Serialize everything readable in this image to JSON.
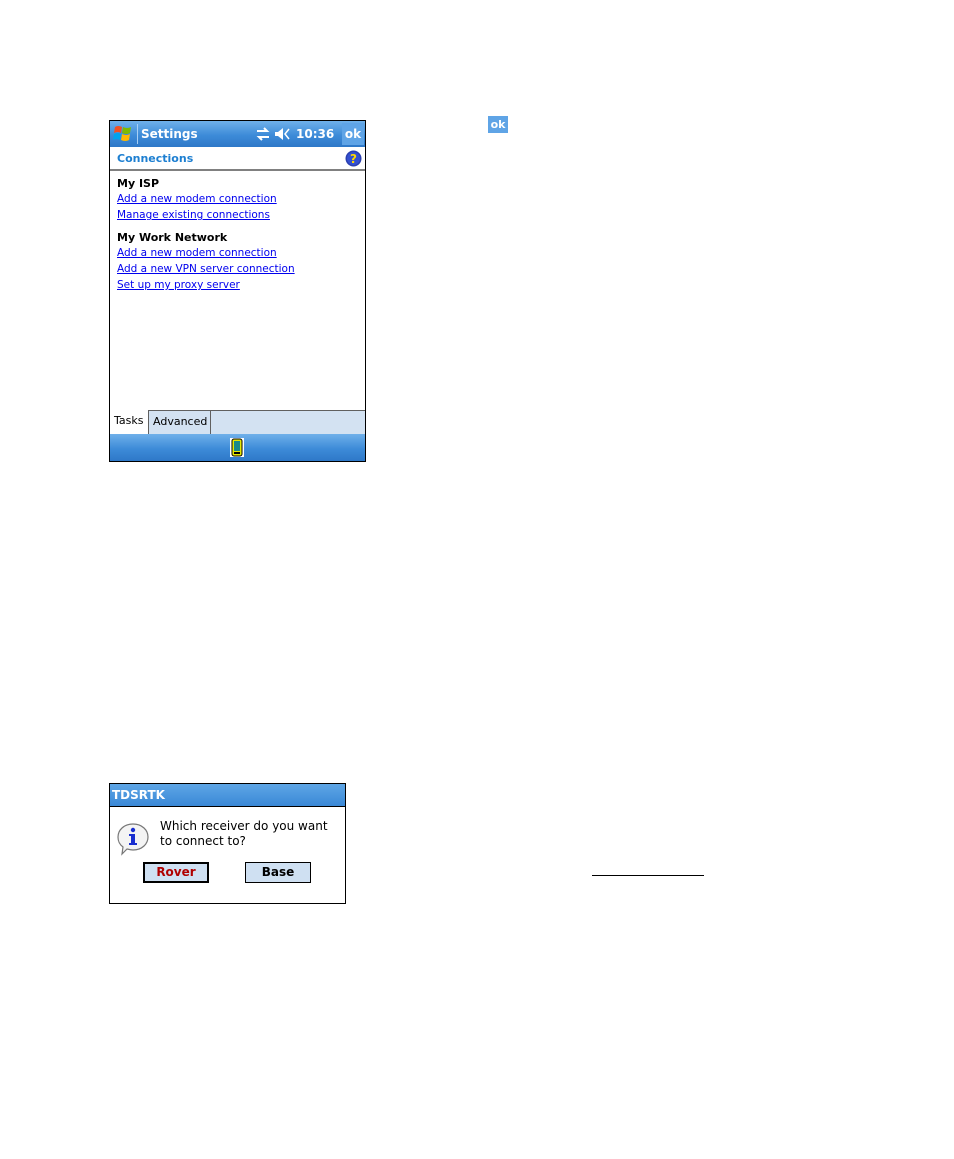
{
  "settings_screen": {
    "titlebar": {
      "app_title": "Settings",
      "clock": "10:36",
      "ok_label": "ok",
      "icons": [
        "windows-start-icon",
        "connectivity-sync-icon",
        "speaker-volume-icon"
      ]
    },
    "header": {
      "title": "Connections",
      "help_icon": "help-icon"
    },
    "sections": [
      {
        "heading": "My ISP",
        "links": [
          "Add a new modem connection",
          "Manage existing connections"
        ]
      },
      {
        "heading": "My Work Network",
        "links": [
          "Add a new modem connection",
          "Add a new VPN server connection",
          "Set up my proxy server"
        ]
      }
    ],
    "tabs": [
      {
        "label": "Tasks",
        "active": true
      },
      {
        "label": "Advanced",
        "active": false
      }
    ],
    "menubar": {
      "icon": "device-receiver-icon"
    }
  },
  "inline_ok_button": {
    "label": "ok"
  },
  "dialog": {
    "title": "TDSRTK",
    "message": "Which receiver do you want to connect to?",
    "icon": "info-icon",
    "buttons": [
      {
        "label": "Rover",
        "default": true
      },
      {
        "label": "Base",
        "default": false
      }
    ]
  },
  "colors": {
    "titlebar_blue": "#3d8bd8",
    "header_title": "#1d7fd1",
    "link": "#0000ee",
    "tab_bar": "#d3e2f2",
    "default_button_text": "#b00000"
  }
}
